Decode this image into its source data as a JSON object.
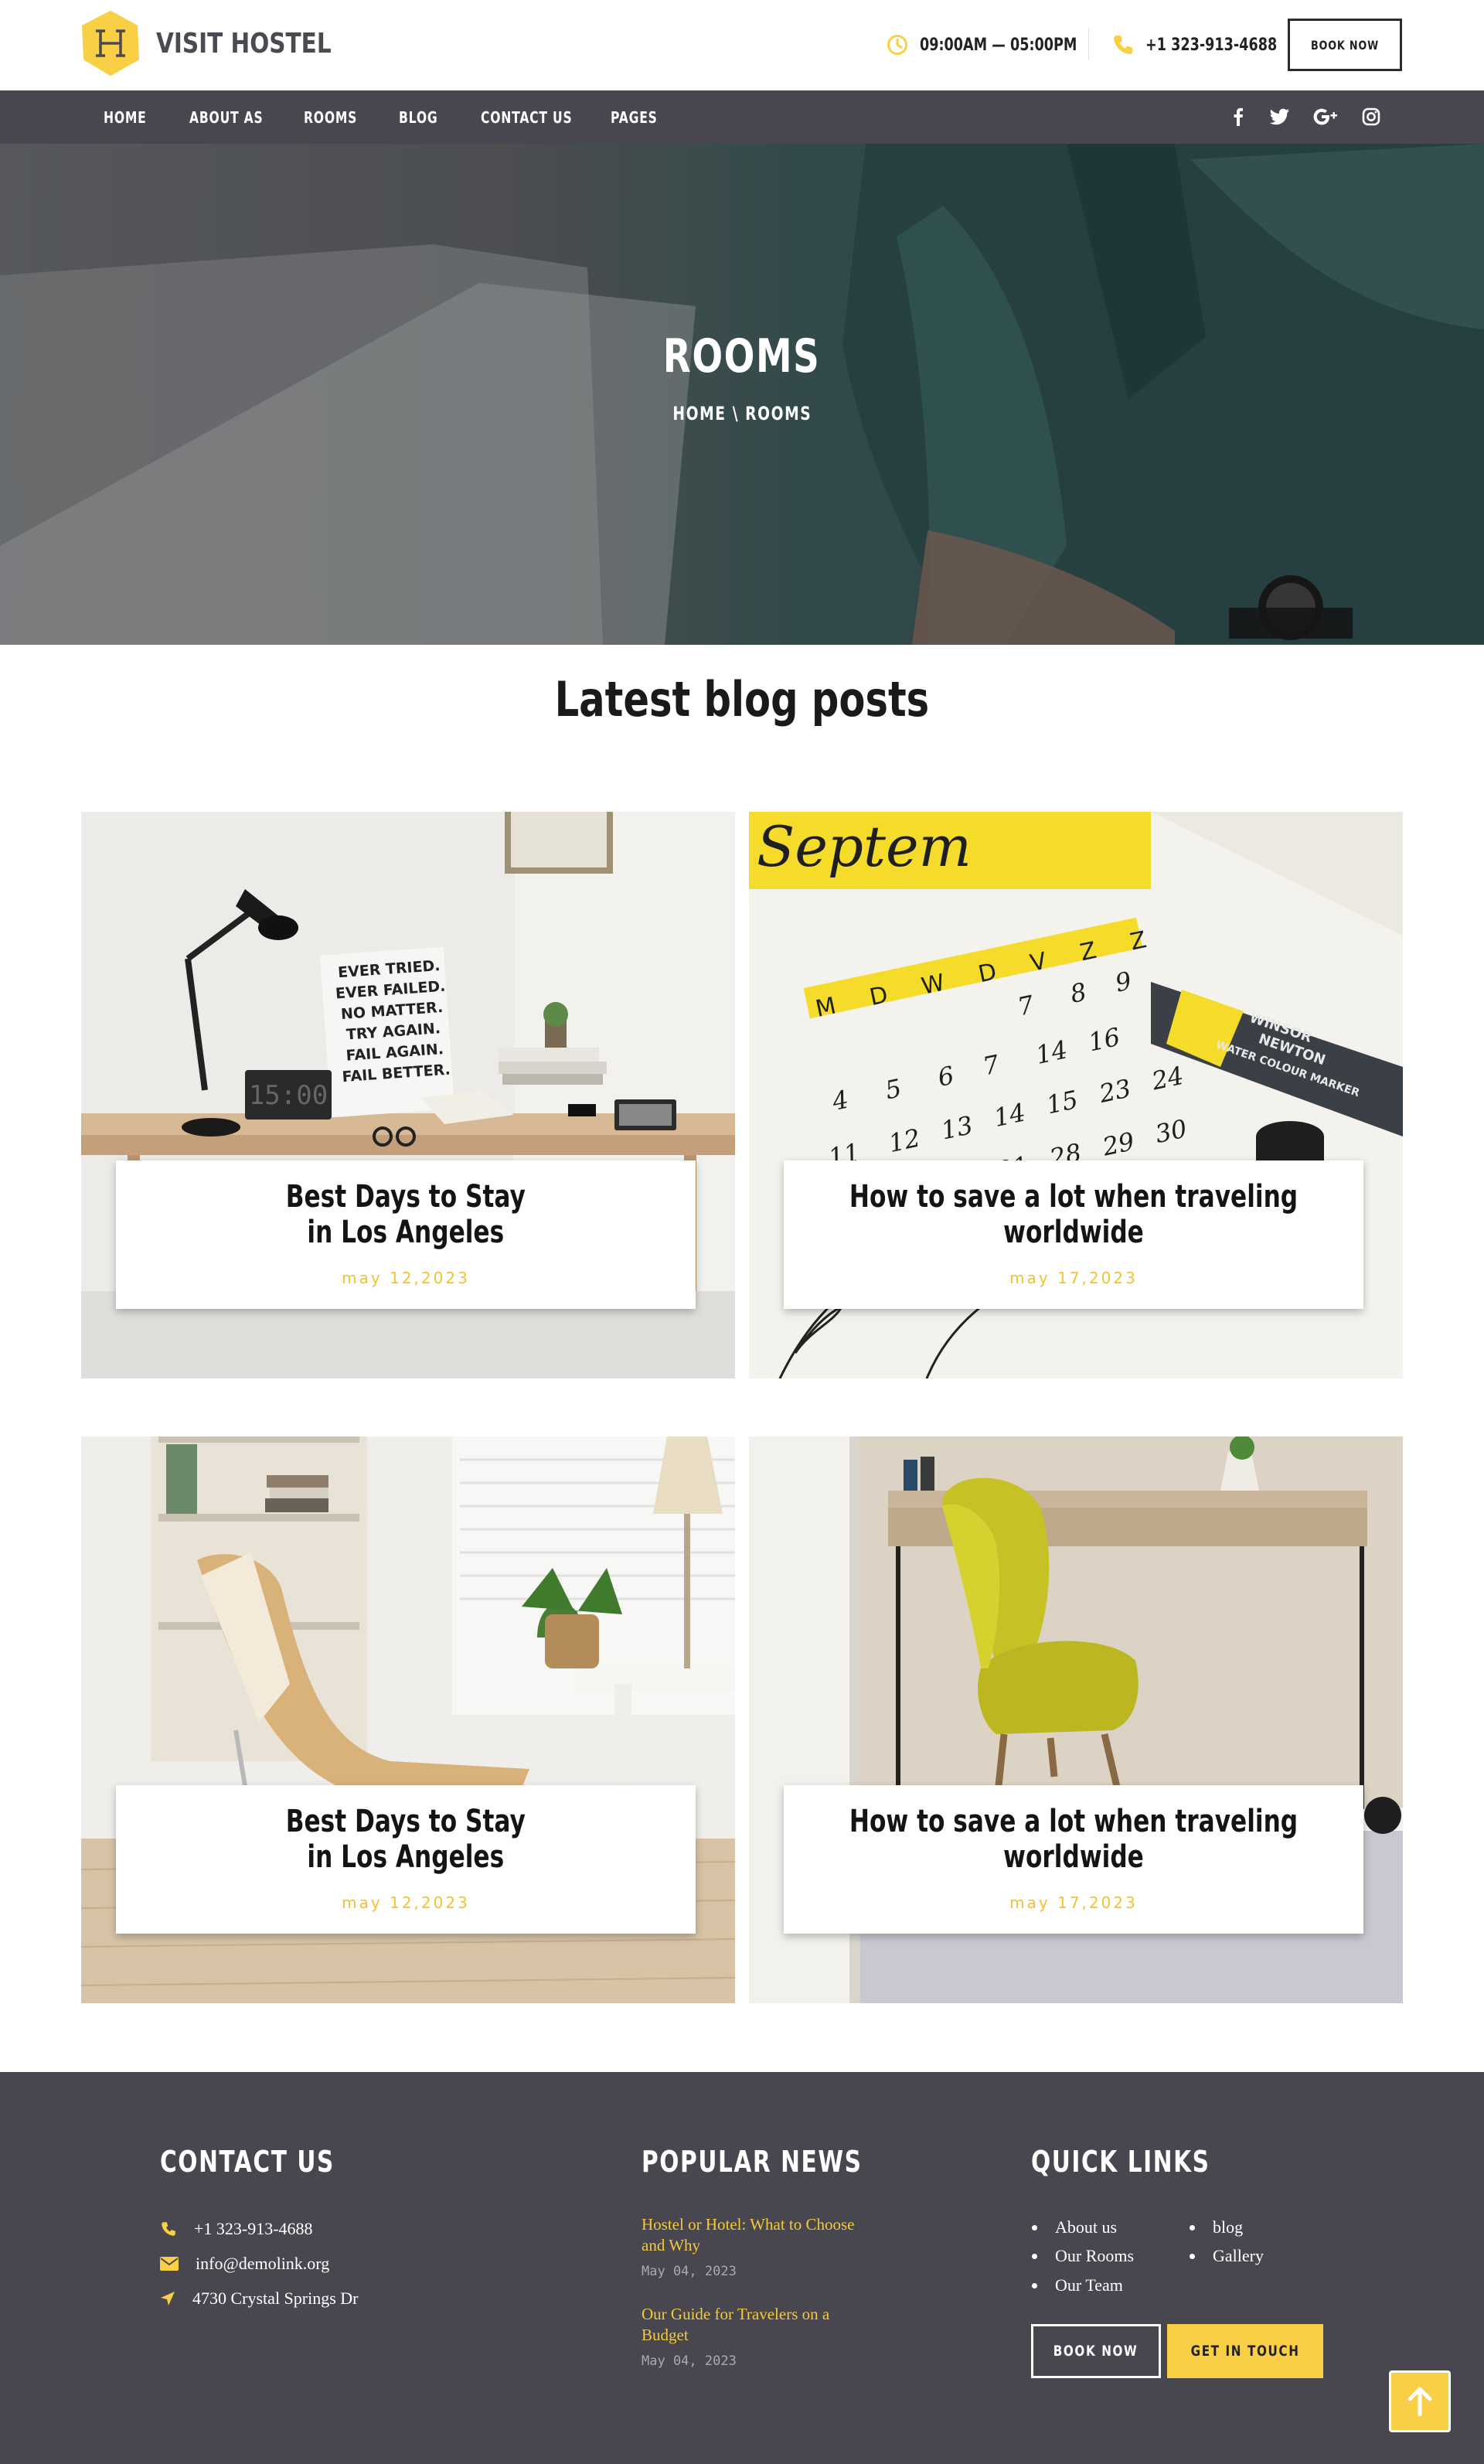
{
  "brand": {
    "name": "VISIT HOSTEL",
    "logo_icon": "hostel-logo-icon",
    "accent": "#f9cf45",
    "dark": "#48474f"
  },
  "header": {
    "hours": "09:00AM — 05:00PM",
    "phone": "+1 323-913-4688",
    "book_now": "BOOK NOW",
    "hours_icon": "clock-icon",
    "phone_icon": "phone-icon"
  },
  "nav": {
    "items": [
      "HOME",
      "ABOUT AS",
      "ROOMS",
      "BLOG",
      "CONTACT US",
      "PAGES"
    ],
    "social": [
      "facebook-icon",
      "twitter-icon",
      "google-plus-icon",
      "instagram-icon"
    ]
  },
  "hero": {
    "title": "ROOMS",
    "breadcrumb": {
      "home": "HOME",
      "separator": "\\",
      "current": "ROOMS"
    }
  },
  "blog": {
    "title": "Latest blog posts",
    "posts": [
      {
        "title": "Best Days to Stay\nin Los Angeles",
        "date": "may 12,2023"
      },
      {
        "title": "How to save a lot when traveling\nworldwide",
        "date": "may 17,2023"
      },
      {
        "title": "Best Days to Stay\nin Los Angeles",
        "date": "may 12,2023"
      },
      {
        "title": "How to save a lot when traveling\nworldwide",
        "date": "may 17,2023"
      }
    ],
    "photo_text": {
      "poster": [
        "EVER TRIED.",
        "EVER FAILED.",
        "NO MATTER.",
        "TRY AGAIN.",
        "FAIL AGAIN.",
        "FAIL BETTER."
      ],
      "clock": "15:00",
      "calendar_heading": "Septem",
      "calendar_days": "M D W D V Z Z",
      "marker_label": [
        "WINSOR",
        "NEWTON",
        "WATER COLOUR MARKER"
      ]
    }
  },
  "footer": {
    "contact": {
      "heading": "CONTACT US",
      "phone": "+1 323-913-4688",
      "email": "info@demolink.org",
      "address": "4730 Crystal Springs Dr"
    },
    "news": {
      "heading": "POPULAR NEWS",
      "items": [
        {
          "title": "Hostel or Hotel: What to Choose and Why",
          "date": "May 04, 2023"
        },
        {
          "title": "Our Guide for Travelers on a Budget",
          "date": "May 04, 2023"
        }
      ]
    },
    "links": {
      "heading": "QUICK LINKS",
      "col1": [
        "About us",
        "Our Rooms",
        "Our Team"
      ],
      "col2": [
        "blog",
        "Gallery"
      ]
    },
    "book_now": "BOOK NOW",
    "get_in_touch": "GET IN TOUCH",
    "scroll_top_icon": "arrow-up-icon"
  }
}
